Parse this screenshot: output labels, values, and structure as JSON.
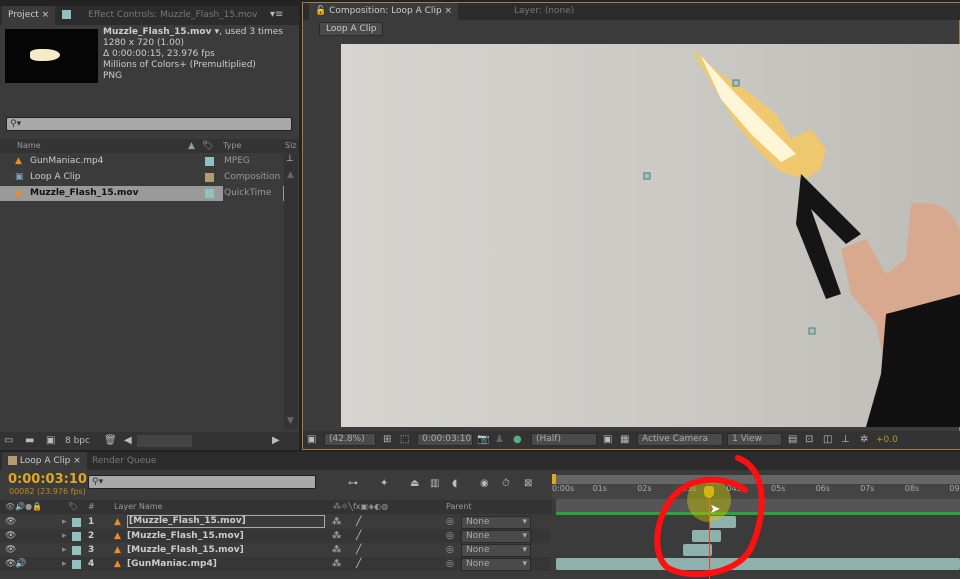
{
  "project_panel": {
    "tabs": [
      {
        "label": "Project"
      },
      {
        "label": "Effect Controls: Muzzle_Flash_15.mov"
      }
    ],
    "info": {
      "name": "Muzzle_Flash_15.mov ▾",
      "used": ", used 3 times",
      "resolution": "1280 x 720 (1.00)",
      "duration": "Δ 0:00:00:15, 23.976 fps",
      "colors": "Millions of Colors+ (Premultiplied)",
      "codec": "PNG"
    },
    "search_placeholder": "",
    "columns": {
      "name": "Name",
      "type": "Type",
      "size": "Siz"
    },
    "items": [
      {
        "name": "GunManiac.mp4",
        "type": "MPEG",
        "icon": "vlc-cone-icon",
        "label_color": "#8fc1c0"
      },
      {
        "name": "Loop A Clip",
        "type": "Composition",
        "icon": "composition-icon",
        "label_color": "#b39c74"
      },
      {
        "name": "Muzzle_Flash_15.mov",
        "type": "QuickTime",
        "icon": "vlc-cone-icon",
        "label_color": "#8fc1c0",
        "selected": true
      }
    ],
    "footer": {
      "bpc": "8 bpc"
    }
  },
  "composition_panel": {
    "tabs": [
      {
        "label": "Composition: Loop A Clip"
      },
      {
        "label": "Layer: (none)"
      }
    ],
    "breadcrumb": "Loop A Clip",
    "toolbar": {
      "zoom": "(42.8%)",
      "timecode": "0:00:03:10",
      "resolution": "(Half)",
      "camera": "Active Camera",
      "views": "1 View",
      "exposure": "+0.0"
    }
  },
  "timeline_panel": {
    "tabs": [
      {
        "label": "Loop A Clip"
      },
      {
        "label": "Render Queue"
      }
    ],
    "current_time": "0:00:03:10",
    "frame_info": "00082 (23.976 fps)",
    "columns": {
      "number": "#",
      "layer_name": "Layer Name",
      "parent": "Parent"
    },
    "ruler": [
      "0:00s",
      "01s",
      "02s",
      "03s",
      "04s",
      "05s",
      "06s",
      "07s",
      "08s",
      "09"
    ],
    "playhead_seconds": 3.42,
    "layers": [
      {
        "num": "1",
        "name": "[Muzzle_Flash_15.mov]",
        "parent": "None",
        "in": 3.42,
        "out": 4.03,
        "audio": false
      },
      {
        "num": "2",
        "name": "[Muzzle_Flash_15.mov]",
        "parent": "None",
        "in": 3.05,
        "out": 3.7,
        "audio": false
      },
      {
        "num": "3",
        "name": "[Muzzle_Flash_15.mov]",
        "parent": "None",
        "in": 2.85,
        "out": 3.5,
        "audio": false
      },
      {
        "num": "4",
        "name": "[GunManiac.mp4]",
        "parent": "None",
        "in": 0,
        "out": 9.1,
        "audio": true
      }
    ]
  },
  "colors": {
    "accent_time": "#e0a820",
    "work_area": "#2aa33a",
    "playhead": "#e8452a",
    "annotation": "#ff1010",
    "layer_bar": "#8fb1ae"
  }
}
